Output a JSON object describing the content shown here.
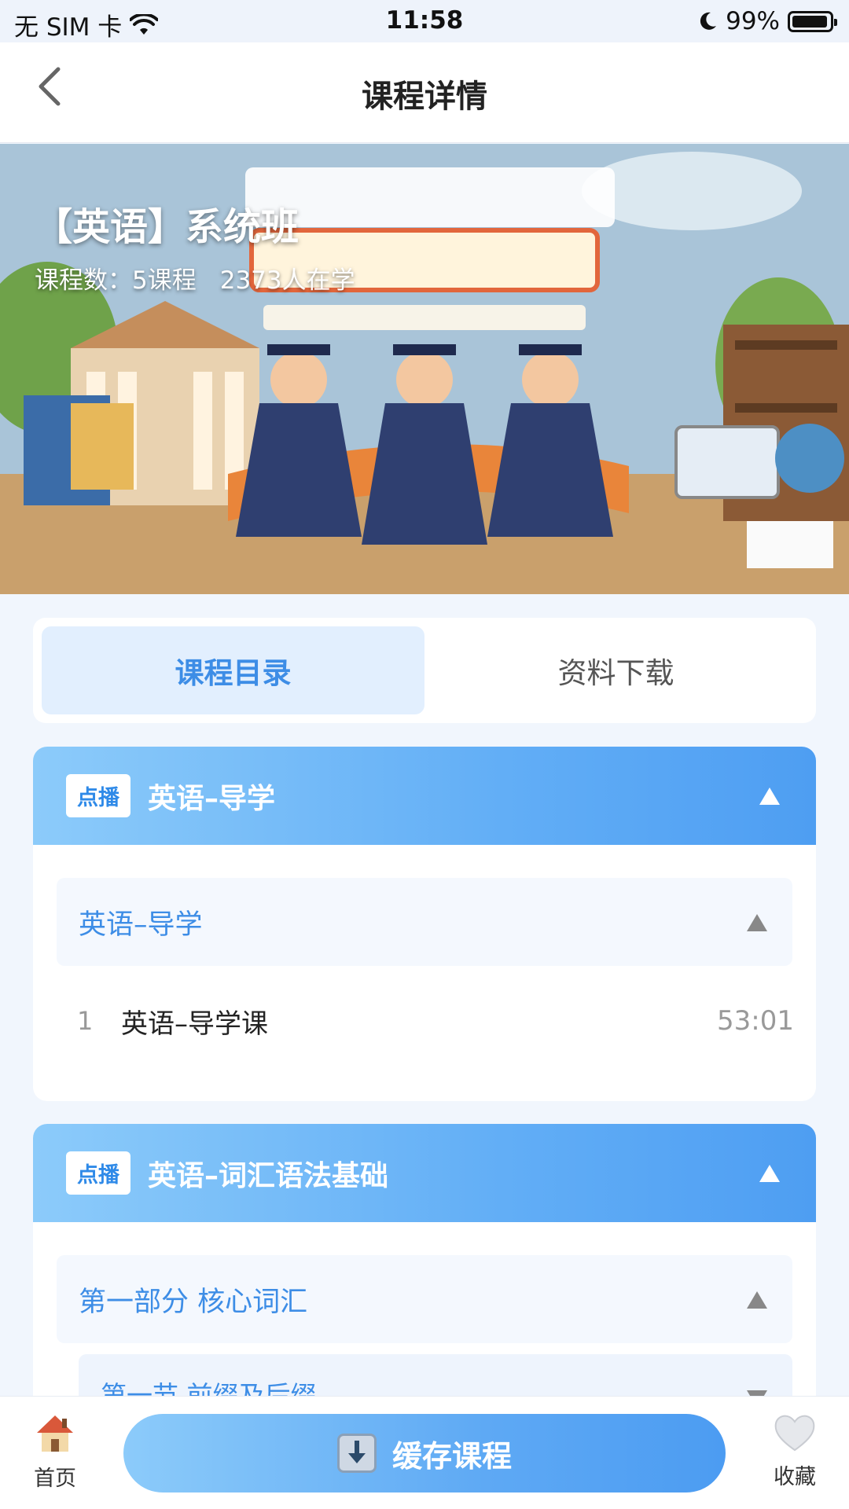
{
  "status_bar": {
    "carrier": "无 SIM 卡",
    "time": "11:58",
    "battery": "99%"
  },
  "nav": {
    "title": "课程详情"
  },
  "banner": {
    "title": "【英语】系统班",
    "course_count": "课程数：5课程",
    "learners": "2373人在学"
  },
  "tabs": [
    {
      "label": "课程目录",
      "active": true
    },
    {
      "label": "资料下载",
      "active": false
    }
  ],
  "courses": [
    {
      "badge": "点播",
      "title": "英语–导学",
      "sections": [
        {
          "title": "英语–导学",
          "lessons": [
            {
              "index": "1",
              "title": "英语–导学课",
              "duration": "53:01"
            }
          ]
        }
      ]
    },
    {
      "badge": "点播",
      "title": "英语–词汇语法基础",
      "sections": [
        {
          "title": "第一部分 核心词汇",
          "subsections": [
            {
              "title": "第一节 前缀及后缀"
            }
          ]
        }
      ]
    }
  ],
  "bottom_bar": {
    "home_label": "首页",
    "cache_label": "缓存课程",
    "favorite_label": "收藏"
  },
  "colors": {
    "accent": "#3d8de6",
    "header_gradient_start": "#8ccbfa",
    "header_gradient_end": "#4e9ef2"
  }
}
